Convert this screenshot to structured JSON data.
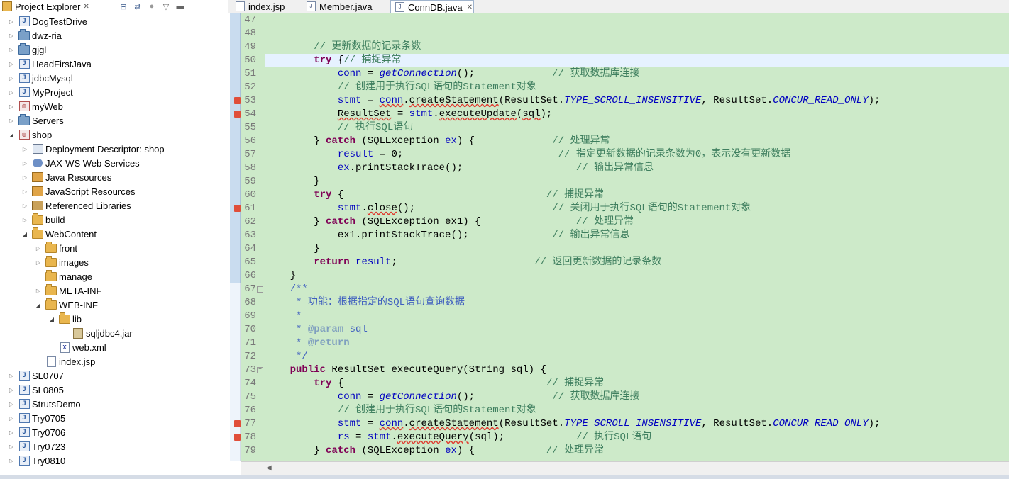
{
  "explorer": {
    "title": "Project Explorer",
    "tree": [
      {
        "label": "DogTestDrive",
        "depth": 0,
        "expanded": false,
        "icon": "java-project-icon"
      },
      {
        "label": "dwz-ria",
        "depth": 0,
        "expanded": false,
        "icon": "project-folder-icon"
      },
      {
        "label": "gjgl",
        "depth": 0,
        "expanded": false,
        "icon": "project-folder-icon"
      },
      {
        "label": "HeadFirstJava",
        "depth": 0,
        "expanded": false,
        "icon": "java-project-icon"
      },
      {
        "label": "jdbcMysql",
        "depth": 0,
        "expanded": false,
        "icon": "java-project-icon"
      },
      {
        "label": "MyProject",
        "depth": 0,
        "expanded": false,
        "icon": "java-project-icon"
      },
      {
        "label": "myWeb",
        "depth": 0,
        "expanded": false,
        "icon": "web-project-icon"
      },
      {
        "label": "Servers",
        "depth": 0,
        "expanded": false,
        "icon": "project-folder-icon"
      },
      {
        "label": "shop",
        "depth": 0,
        "expanded": true,
        "icon": "web-project-icon"
      },
      {
        "label": "Deployment Descriptor: shop",
        "depth": 1,
        "expanded": false,
        "icon": "deployment-descriptor-icon"
      },
      {
        "label": "JAX-WS Web Services",
        "depth": 1,
        "expanded": false,
        "icon": "web-services-icon"
      },
      {
        "label": "Java Resources",
        "depth": 1,
        "expanded": false,
        "icon": "java-resources-icon"
      },
      {
        "label": "JavaScript Resources",
        "depth": 1,
        "expanded": false,
        "icon": "javascript-resources-icon"
      },
      {
        "label": "Referenced Libraries",
        "depth": 1,
        "expanded": false,
        "icon": "library-icon"
      },
      {
        "label": "build",
        "depth": 1,
        "expanded": false,
        "icon": "folder-icon"
      },
      {
        "label": "WebContent",
        "depth": 1,
        "expanded": true,
        "icon": "folder-icon"
      },
      {
        "label": "front",
        "depth": 2,
        "expanded": false,
        "icon": "folder-icon"
      },
      {
        "label": "images",
        "depth": 2,
        "expanded": false,
        "icon": "folder-icon"
      },
      {
        "label": "manage",
        "depth": 2,
        "expanded": null,
        "icon": "folder-icon"
      },
      {
        "label": "META-INF",
        "depth": 2,
        "expanded": false,
        "icon": "folder-icon"
      },
      {
        "label": "WEB-INF",
        "depth": 2,
        "expanded": true,
        "icon": "folder-icon"
      },
      {
        "label": "lib",
        "depth": 3,
        "expanded": true,
        "icon": "folder-icon"
      },
      {
        "label": "sqljdbc4.jar",
        "depth": 4,
        "expanded": null,
        "icon": "jar-icon"
      },
      {
        "label": "web.xml",
        "depth": 3,
        "expanded": null,
        "icon": "xml-file-icon"
      },
      {
        "label": "index.jsp",
        "depth": 2,
        "expanded": null,
        "icon": "jsp-file-icon"
      },
      {
        "label": "SL0707",
        "depth": 0,
        "expanded": false,
        "icon": "java-project-icon"
      },
      {
        "label": "SL0805",
        "depth": 0,
        "expanded": false,
        "icon": "java-project-icon"
      },
      {
        "label": "StrutsDemo",
        "depth": 0,
        "expanded": false,
        "icon": "java-project-icon"
      },
      {
        "label": "Try0705",
        "depth": 0,
        "expanded": false,
        "icon": "java-project-icon"
      },
      {
        "label": "Try0706",
        "depth": 0,
        "expanded": false,
        "icon": "java-project-icon"
      },
      {
        "label": "Try0723",
        "depth": 0,
        "expanded": false,
        "icon": "java-project-icon"
      },
      {
        "label": "Try0810",
        "depth": 0,
        "expanded": false,
        "icon": "java-project-icon"
      }
    ]
  },
  "editor": {
    "tabs": [
      {
        "label": "index.jsp",
        "active": false
      },
      {
        "label": "Member.java",
        "active": false
      },
      {
        "label": "ConnDB.java",
        "active": true
      }
    ],
    "lines": [
      {
        "n": "47",
        "fold": null,
        "err": false,
        "cur": false,
        "segs": []
      },
      {
        "n": "48",
        "fold": null,
        "err": false,
        "cur": false,
        "segs": []
      },
      {
        "n": "49",
        "fold": null,
        "err": false,
        "cur": false,
        "segs": [
          [
            "        ",
            ""
          ],
          [
            "// 更新数据的记录条数",
            "cm"
          ]
        ]
      },
      {
        "n": "50",
        "fold": null,
        "err": false,
        "cur": true,
        "segs": [
          [
            "        ",
            ""
          ],
          [
            "try",
            "kw"
          ],
          [
            " {",
            ""
          ],
          [
            "// 捕捉异常",
            "cm"
          ]
        ]
      },
      {
        "n": "51",
        "fold": null,
        "err": false,
        "cur": false,
        "segs": [
          [
            "            ",
            ""
          ],
          [
            "conn",
            "fld"
          ],
          [
            " = ",
            ""
          ],
          [
            "getConnection",
            "st"
          ],
          [
            "();             ",
            ""
          ],
          [
            "// 获取数据库连接",
            "cm"
          ]
        ]
      },
      {
        "n": "52",
        "fold": null,
        "err": false,
        "cur": false,
        "segs": [
          [
            "            ",
            ""
          ],
          [
            "// 创建用于执行SQL语句的Statement对象",
            "cm"
          ]
        ]
      },
      {
        "n": "53",
        "fold": null,
        "err": true,
        "cur": false,
        "segs": [
          [
            "            ",
            ""
          ],
          [
            "stmt",
            "fld"
          ],
          [
            " = ",
            ""
          ],
          [
            "conn",
            "fld sq"
          ],
          [
            ".",
            ""
          ],
          [
            "createStatement",
            "sq"
          ],
          [
            "(ResultSet.",
            ""
          ],
          [
            "TYPE_SCROLL_INSENSITIVE",
            "st"
          ],
          [
            ", ResultSet.",
            ""
          ],
          [
            "CONCUR_READ_ONLY",
            "st"
          ],
          [
            ");",
            ""
          ]
        ]
      },
      {
        "n": "54",
        "fold": null,
        "err": true,
        "cur": false,
        "segs": [
          [
            "            ",
            ""
          ],
          [
            "ResultSet",
            "sq"
          ],
          [
            " = ",
            ""
          ],
          [
            "stmt",
            "fld"
          ],
          [
            ".",
            ""
          ],
          [
            "executeUpdate",
            "sq"
          ],
          [
            "(",
            ""
          ],
          [
            "sql",
            "sq"
          ],
          [
            ");",
            ""
          ]
        ]
      },
      {
        "n": "55",
        "fold": null,
        "err": false,
        "cur": false,
        "segs": [
          [
            "            ",
            ""
          ],
          [
            "// 执行SQL语句",
            "cm"
          ]
        ]
      },
      {
        "n": "56",
        "fold": null,
        "err": false,
        "cur": false,
        "segs": [
          [
            "        } ",
            ""
          ],
          [
            "catch",
            "kw"
          ],
          [
            " (SQLException ",
            ""
          ],
          [
            "ex",
            "fld"
          ],
          [
            ") {             ",
            ""
          ],
          [
            "// 处理异常",
            "cm"
          ]
        ]
      },
      {
        "n": "57",
        "fold": null,
        "err": false,
        "cur": false,
        "segs": [
          [
            "            ",
            ""
          ],
          [
            "result",
            "fld"
          ],
          [
            " = 0;                          ",
            ""
          ],
          [
            "// 指定更新数据的记录条数为0，表示没有更新数据",
            "cm"
          ]
        ]
      },
      {
        "n": "58",
        "fold": null,
        "err": false,
        "cur": false,
        "segs": [
          [
            "            ",
            ""
          ],
          [
            "ex",
            "fld"
          ],
          [
            ".printStackTrace();                   ",
            ""
          ],
          [
            "// 输出异常信息",
            "cm"
          ]
        ]
      },
      {
        "n": "59",
        "fold": null,
        "err": false,
        "cur": false,
        "segs": [
          [
            "        }",
            ""
          ]
        ]
      },
      {
        "n": "60",
        "fold": null,
        "err": false,
        "cur": false,
        "segs": [
          [
            "        ",
            ""
          ],
          [
            "try",
            "kw"
          ],
          [
            " {                                  ",
            ""
          ],
          [
            "// 捕捉异常",
            "cm"
          ]
        ]
      },
      {
        "n": "61",
        "fold": null,
        "err": true,
        "cur": false,
        "segs": [
          [
            "            ",
            ""
          ],
          [
            "stmt",
            "fld"
          ],
          [
            ".",
            ""
          ],
          [
            "close",
            "sq"
          ],
          [
            "();                       ",
            ""
          ],
          [
            "// 关闭用于执行SQL语句的Statement对象",
            "cm"
          ]
        ]
      },
      {
        "n": "62",
        "fold": null,
        "err": false,
        "cur": false,
        "segs": [
          [
            "        } ",
            ""
          ],
          [
            "catch",
            "kw"
          ],
          [
            " (SQLException ex1) {                ",
            ""
          ],
          [
            "// 处理异常",
            "cm"
          ]
        ]
      },
      {
        "n": "63",
        "fold": null,
        "err": false,
        "cur": false,
        "segs": [
          [
            "            ex1.printStackTrace();              ",
            ""
          ],
          [
            "// 输出异常信息",
            "cm"
          ]
        ]
      },
      {
        "n": "64",
        "fold": null,
        "err": false,
        "cur": false,
        "segs": [
          [
            "        }",
            ""
          ]
        ]
      },
      {
        "n": "65",
        "fold": null,
        "err": false,
        "cur": false,
        "segs": [
          [
            "        ",
            ""
          ],
          [
            "return",
            "kw"
          ],
          [
            " ",
            ""
          ],
          [
            "result",
            "fld"
          ],
          [
            ";                       ",
            ""
          ],
          [
            "// 返回更新数据的记录条数",
            "cm"
          ]
        ]
      },
      {
        "n": "66",
        "fold": null,
        "err": false,
        "cur": false,
        "segs": [
          [
            "    }",
            ""
          ]
        ]
      },
      {
        "n": "67",
        "fold": "−",
        "err": false,
        "cur": false,
        "segs": [
          [
            "    ",
            ""
          ],
          [
            "/**",
            "jd"
          ]
        ]
      },
      {
        "n": "68",
        "fold": null,
        "err": false,
        "cur": false,
        "segs": [
          [
            "     ",
            ""
          ],
          [
            "* 功能：根据指定的SQL语句查询数据",
            "jd"
          ]
        ]
      },
      {
        "n": "69",
        "fold": null,
        "err": false,
        "cur": false,
        "segs": [
          [
            "     ",
            ""
          ],
          [
            "*",
            "jd"
          ]
        ]
      },
      {
        "n": "70",
        "fold": null,
        "err": false,
        "cur": false,
        "segs": [
          [
            "     ",
            ""
          ],
          [
            "* ",
            "jd"
          ],
          [
            "@param",
            "jt"
          ],
          [
            " sql",
            "jd"
          ]
        ]
      },
      {
        "n": "71",
        "fold": null,
        "err": false,
        "cur": false,
        "segs": [
          [
            "     ",
            ""
          ],
          [
            "* ",
            "jd"
          ],
          [
            "@return",
            "jt"
          ]
        ]
      },
      {
        "n": "72",
        "fold": null,
        "err": false,
        "cur": false,
        "segs": [
          [
            "     ",
            ""
          ],
          [
            "*/",
            "jd"
          ]
        ]
      },
      {
        "n": "73",
        "fold": "−",
        "err": false,
        "cur": false,
        "segs": [
          [
            "    ",
            ""
          ],
          [
            "public",
            "kw"
          ],
          [
            " ResultSet executeQuery(String sql) {",
            ""
          ]
        ]
      },
      {
        "n": "74",
        "fold": null,
        "err": false,
        "cur": false,
        "segs": [
          [
            "        ",
            ""
          ],
          [
            "try",
            "kw"
          ],
          [
            " {                                  ",
            ""
          ],
          [
            "// 捕捉异常",
            "cm"
          ]
        ]
      },
      {
        "n": "75",
        "fold": null,
        "err": false,
        "cur": false,
        "segs": [
          [
            "            ",
            ""
          ],
          [
            "conn",
            "fld"
          ],
          [
            " = ",
            ""
          ],
          [
            "getConnection",
            "st"
          ],
          [
            "();             ",
            ""
          ],
          [
            "// 获取数据库连接",
            "cm"
          ]
        ]
      },
      {
        "n": "76",
        "fold": null,
        "err": false,
        "cur": false,
        "segs": [
          [
            "            ",
            ""
          ],
          [
            "// 创建用于执行SQL语句的Statement对象",
            "cm"
          ]
        ]
      },
      {
        "n": "77",
        "fold": null,
        "err": true,
        "cur": false,
        "segs": [
          [
            "            ",
            ""
          ],
          [
            "stmt",
            "fld"
          ],
          [
            " = ",
            ""
          ],
          [
            "conn",
            "fld sq"
          ],
          [
            ".",
            ""
          ],
          [
            "createStatement",
            "sq"
          ],
          [
            "(ResultSet.",
            ""
          ],
          [
            "TYPE_SCROLL_INSENSITIVE",
            "st"
          ],
          [
            ", ResultSet.",
            ""
          ],
          [
            "CONCUR_READ_ONLY",
            "st"
          ],
          [
            ");",
            ""
          ]
        ]
      },
      {
        "n": "78",
        "fold": null,
        "err": true,
        "cur": false,
        "segs": [
          [
            "            ",
            ""
          ],
          [
            "rs",
            "fld"
          ],
          [
            " = ",
            ""
          ],
          [
            "stmt",
            "fld"
          ],
          [
            ".",
            ""
          ],
          [
            "executeQuery",
            "sq"
          ],
          [
            "(sql);            ",
            ""
          ],
          [
            "// 执行SQL语句",
            "cm"
          ]
        ]
      },
      {
        "n": "79",
        "fold": null,
        "err": false,
        "cur": false,
        "segs": [
          [
            "        } ",
            ""
          ],
          [
            "catch",
            "kw"
          ],
          [
            " (SQLException ",
            ""
          ],
          [
            "ex",
            "fld"
          ],
          [
            ") {            ",
            ""
          ],
          [
            "// 处理异常",
            "cm"
          ]
        ]
      }
    ]
  },
  "colors": {
    "editor_bg": "#cdeac9",
    "keyword": "#7f0055",
    "comment": "#3f7f5f",
    "javadoc": "#3f5fbf",
    "field": "#0000c0"
  }
}
